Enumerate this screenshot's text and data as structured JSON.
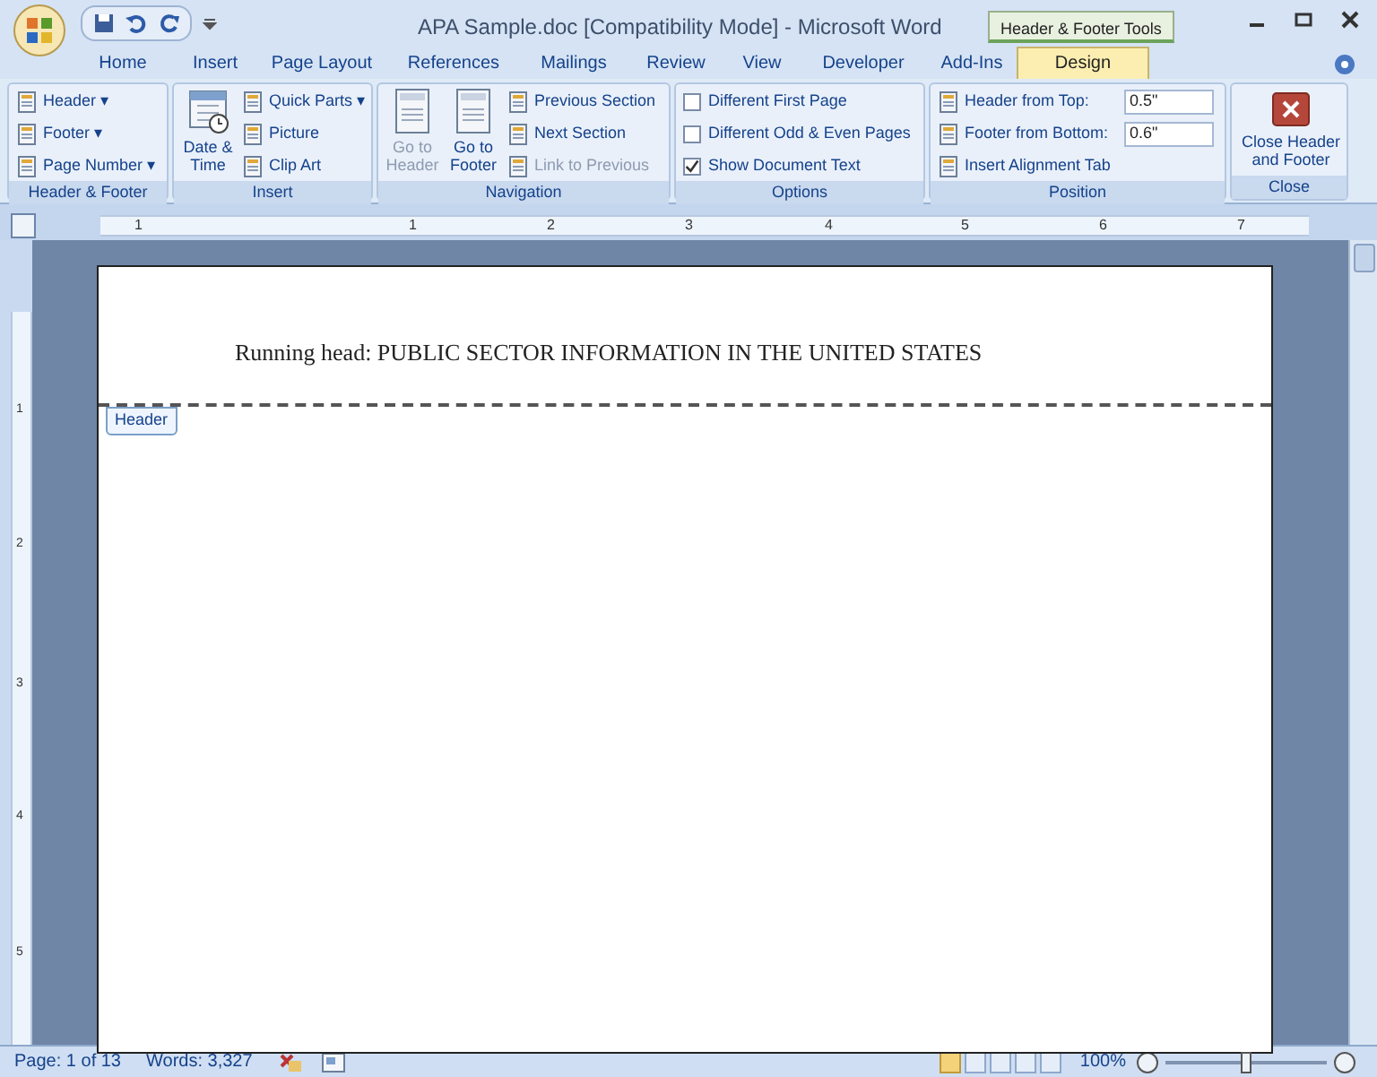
{
  "window": {
    "title": "APA Sample.doc [Compatibility Mode] - Microsoft Word",
    "contextual_tab_group": "Header & Footer Tools"
  },
  "tabs": [
    {
      "label": "Home",
      "selected": false
    },
    {
      "label": "Insert",
      "selected": false
    },
    {
      "label": "Page Layout",
      "selected": false
    },
    {
      "label": "References",
      "selected": false
    },
    {
      "label": "Mailings",
      "selected": false
    },
    {
      "label": "Review",
      "selected": false
    },
    {
      "label": "View",
      "selected": false
    },
    {
      "label": "Developer",
      "selected": false
    },
    {
      "label": "Add-Ins",
      "selected": false
    },
    {
      "label": "Design",
      "selected": true
    }
  ],
  "ribbon_groups": [
    {
      "name": "Header & Footer",
      "columns": [
        [
          {
            "kind": "small",
            "label": "Header ▾",
            "disabled": false
          },
          {
            "kind": "small",
            "label": "Footer ▾",
            "disabled": false
          },
          {
            "kind": "small",
            "label": "Page Number ▾",
            "disabled": false
          }
        ]
      ]
    },
    {
      "name": "Insert",
      "columns": [
        [
          {
            "kind": "large",
            "label": "Date & Time",
            "disabled": false
          }
        ],
        [
          {
            "kind": "small",
            "label": "Quick Parts ▾",
            "disabled": false
          },
          {
            "kind": "small",
            "label": "Picture",
            "disabled": false
          },
          {
            "kind": "small",
            "label": "Clip Art",
            "disabled": false
          }
        ]
      ]
    },
    {
      "name": "Navigation",
      "columns": [
        [
          {
            "kind": "large",
            "label": "Go to Header",
            "disabled": true
          }
        ],
        [
          {
            "kind": "large",
            "label": "Go to Footer",
            "disabled": false
          }
        ],
        [
          {
            "kind": "small",
            "label": "Previous Section",
            "disabled": false
          },
          {
            "kind": "small",
            "label": "Next Section",
            "disabled": false
          },
          {
            "kind": "small",
            "label": "Link to Previous",
            "disabled": true
          }
        ]
      ]
    },
    {
      "name": "Options",
      "columns": [
        [
          {
            "kind": "checkbox",
            "label": "Different First Page",
            "checked": false
          },
          {
            "kind": "checkbox",
            "label": "Different Odd & Even Pages",
            "checked": false
          },
          {
            "kind": "checkbox",
            "label": "Show Document Text",
            "checked": true
          }
        ]
      ]
    },
    {
      "name": "Position",
      "columns": [
        [
          {
            "kind": "spin",
            "label": "Header from Top:",
            "value": "0.5\""
          },
          {
            "kind": "spin",
            "label": "Footer from Bottom:",
            "value": "0.6\""
          },
          {
            "kind": "small",
            "label": "Insert Alignment Tab",
            "disabled": false
          }
        ]
      ]
    },
    {
      "name": "Close",
      "columns": [
        [
          {
            "kind": "close",
            "label": "Close Header and Footer"
          }
        ]
      ]
    }
  ],
  "ruler": {
    "labels": [
      "1",
      "1",
      "2",
      "3",
      "4",
      "5",
      "6",
      "7"
    ]
  },
  "vertical_ruler": {
    "labels": [
      "1",
      "2",
      "3",
      "4",
      "5"
    ]
  },
  "document": {
    "header_text": "Running head: PUBLIC SECTOR INFORMATION IN THE UNITED STATES",
    "header_tag": "Header"
  },
  "status_bar": {
    "page": "Page: 1 of 13",
    "words": "Words: 3,327",
    "zoom": "100%",
    "level": 0.5
  }
}
